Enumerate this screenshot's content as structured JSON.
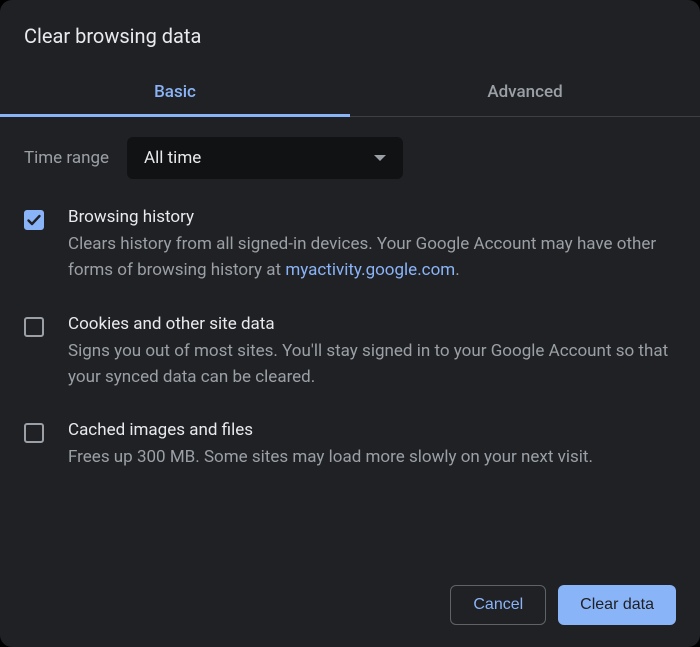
{
  "dialog": {
    "title": "Clear browsing data"
  },
  "tabs": {
    "basic": "Basic",
    "advanced": "Advanced",
    "active": "basic"
  },
  "timerange": {
    "label": "Time range",
    "selected": "All time"
  },
  "options": {
    "history": {
      "title": "Browsing history",
      "desc_pre": "Clears history from all signed-in devices. Your Google Account may have other forms of browsing history at ",
      "desc_link": "myactivity.google.com",
      "desc_post": ".",
      "checked": true
    },
    "cookies": {
      "title": "Cookies and other site data",
      "desc": "Signs you out of most sites. You'll stay signed in to your Google Account so that your synced data can be cleared.",
      "checked": false
    },
    "cache": {
      "title": "Cached images and files",
      "desc": "Frees up 300 MB. Some sites may load more slowly on your next visit.",
      "checked": false
    }
  },
  "footer": {
    "cancel": "Cancel",
    "clear": "Clear data"
  },
  "colors": {
    "accent": "#8ab4f8",
    "bg": "#202124",
    "text": "#e8eaed",
    "muted": "#9aa0a6"
  }
}
